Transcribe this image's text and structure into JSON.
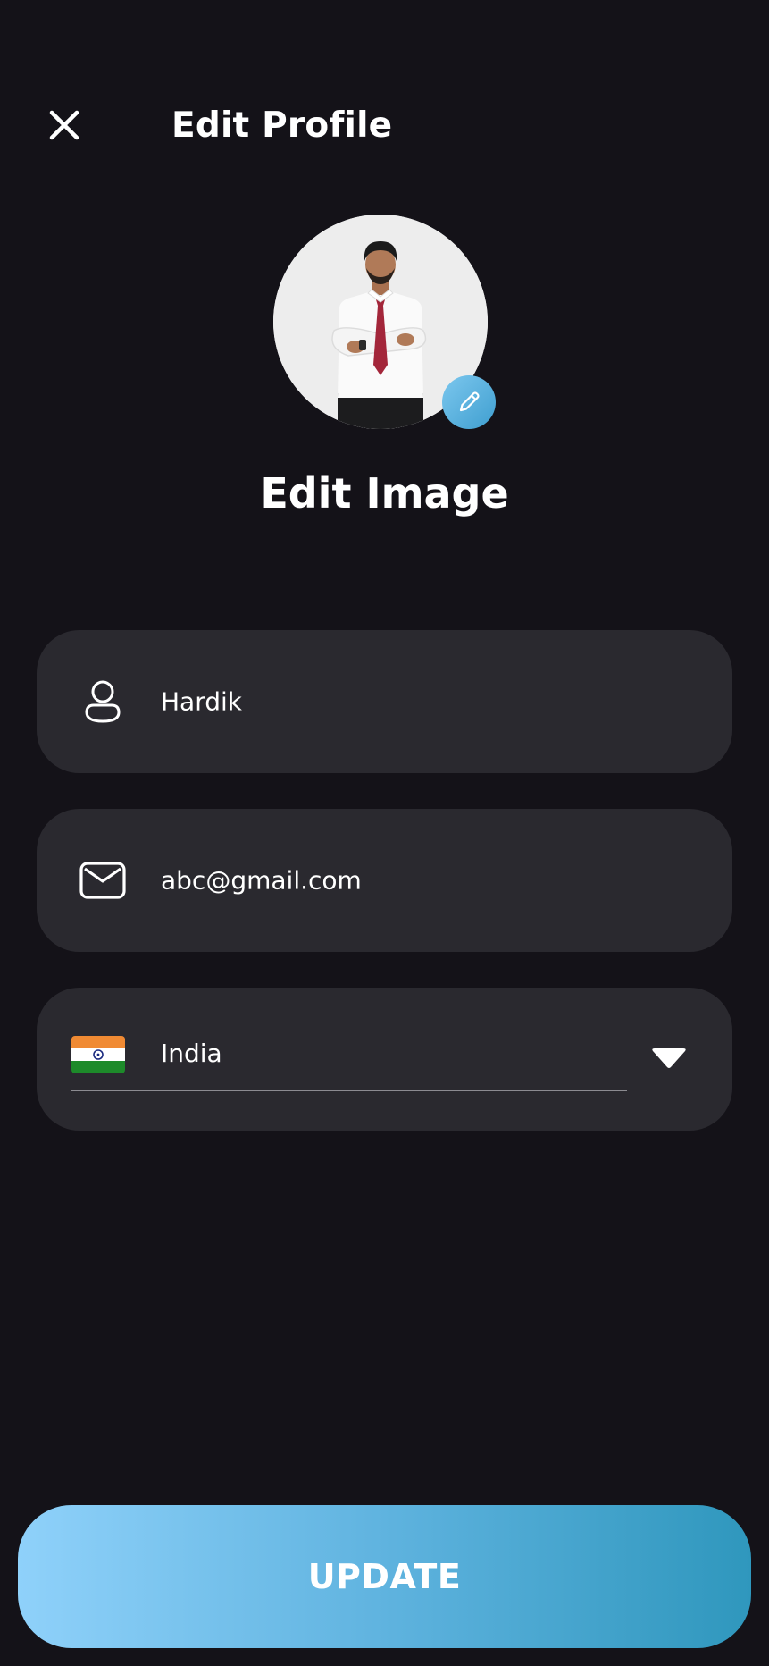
{
  "header": {
    "title": "Edit Profile",
    "close_icon": "close-icon"
  },
  "profile": {
    "edit_image_label": "Edit Image",
    "edit_icon": "pencil-icon"
  },
  "form": {
    "name": {
      "icon": "user-icon",
      "value": "Hardik"
    },
    "email": {
      "icon": "mail-icon",
      "value": "abc@gmail.com"
    },
    "country": {
      "flag": "india-flag-icon",
      "value": "India",
      "dropdown_icon": "caret-down-icon"
    }
  },
  "actions": {
    "update_label": "UPDATE"
  },
  "colors": {
    "background": "#141218",
    "field_background": "#2a292f",
    "accent_light": "#8fd1fa",
    "accent_dark": "#2f97bd"
  }
}
